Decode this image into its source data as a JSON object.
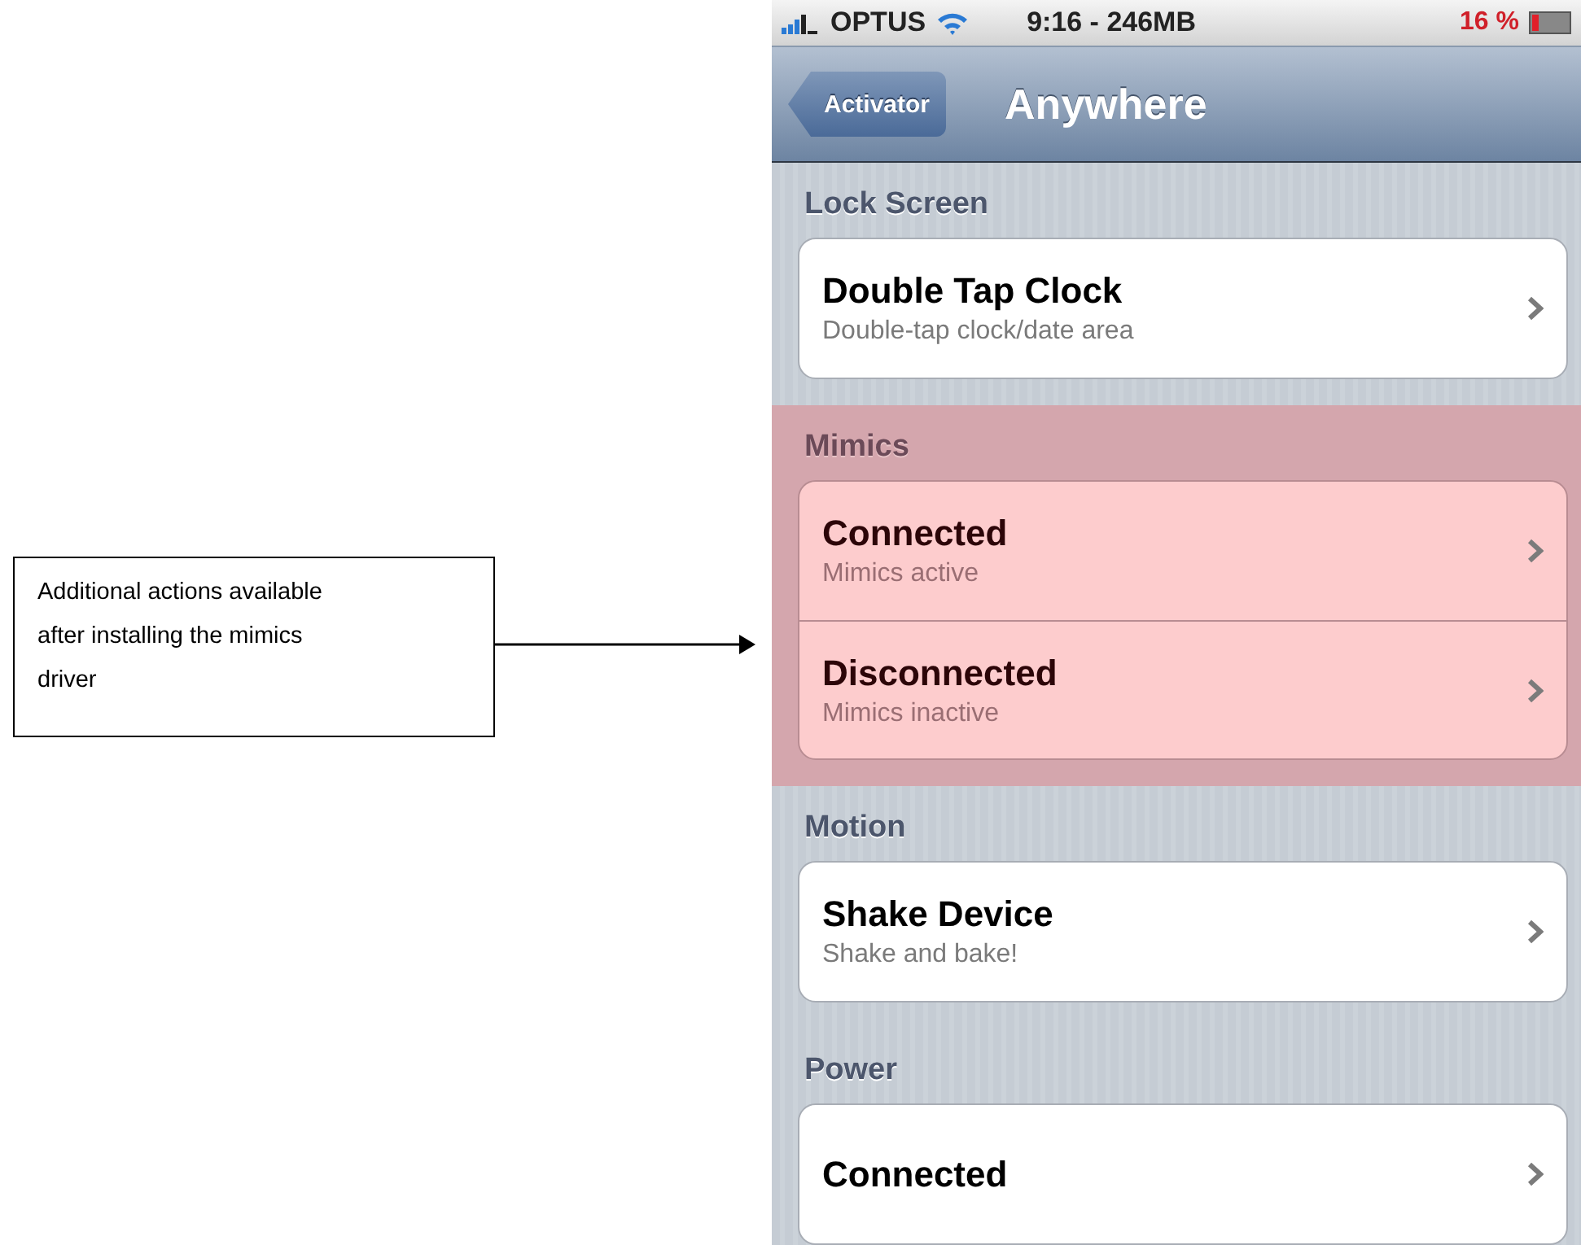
{
  "callout": {
    "text": "Additional actions available after installing the mimics driver"
  },
  "status_bar": {
    "carrier": "OPTUS",
    "time": "9:16 - 246MB",
    "battery": "16 %"
  },
  "nav_bar": {
    "back_button": "Activator",
    "title": "Anywhere"
  },
  "sections": [
    {
      "header": "Lock Screen",
      "highlighted": false,
      "rows": [
        {
          "title": "Double Tap Clock",
          "subtitle": "Double-tap clock/date area"
        }
      ]
    },
    {
      "header": "Mimics",
      "highlighted": true,
      "rows": [
        {
          "title": "Connected",
          "subtitle": "Mimics active"
        },
        {
          "title": "Disconnected",
          "subtitle": "Mimics inactive"
        }
      ]
    },
    {
      "header": "Motion",
      "highlighted": false,
      "rows": [
        {
          "title": "Shake Device",
          "subtitle": "Shake and bake!"
        }
      ]
    },
    {
      "header": "Power",
      "highlighted": false,
      "rows": [
        {
          "title": "Connected"
        }
      ]
    }
  ]
}
